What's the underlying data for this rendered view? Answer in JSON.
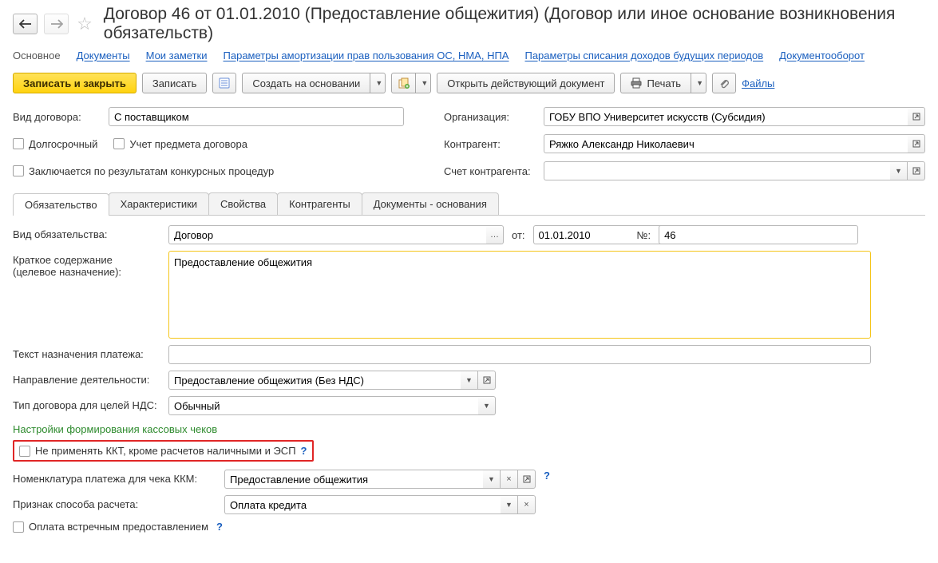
{
  "header": {
    "title": "Договор 46 от 01.01.2010 (Предоставление общежития) (Договор или иное основание возникновения обязательств)"
  },
  "nav": {
    "main": "Основное",
    "docs": "Документы",
    "notes": "Мои заметки",
    "amort": "Параметры амортизации прав пользования ОС, НМА, НПА",
    "income": "Параметры списания доходов будущих периодов",
    "workflow": "Документооборот"
  },
  "toolbar": {
    "save_close": "Записать и закрыть",
    "save": "Записать",
    "create_based": "Создать на основании",
    "open_active": "Открыть действующий документ",
    "print": "Печать",
    "files": "Файлы"
  },
  "left": {
    "contract_type_label": "Вид договора:",
    "contract_type_value": "С поставщиком",
    "long_term": "Долгосрочный",
    "track_subject": "Учет предмета договора",
    "by_tender": "Заключается по результатам конкурсных процедур"
  },
  "right": {
    "org_label": "Организация:",
    "org_value": "ГОБУ ВПО Университет искусств (Субсидия)",
    "counterparty_label": "Контрагент:",
    "counterparty_value": "Ряжко Александр Николаевич",
    "account_label": "Счет контрагента:",
    "account_value": ""
  },
  "tabs": {
    "t1": "Обязательство",
    "t2": "Характеристики",
    "t3": "Свойства",
    "t4": "Контрагенты",
    "t5": "Документы - основания"
  },
  "obl": {
    "kind_label": "Вид обязательства:",
    "kind_value": "Договор",
    "from_label": "от:",
    "date_value": "01.01.2010",
    "num_label": "№:",
    "num_value": "46",
    "summary_label1": "Краткое содержание",
    "summary_label2": "(целевое назначение):",
    "summary_value": "Предоставление общежития",
    "payment_text_label": "Текст назначения платежа:",
    "payment_text_value": "",
    "activity_label": "Направление деятельности:",
    "activity_value": "Предоставление общежития (Без НДС)",
    "vat_type_label": "Тип договора для целей НДС:",
    "vat_type_value": "Обычный",
    "section_title": "Настройки формирования кассовых чеков",
    "no_kkt_label": "Не применять ККТ, кроме расчетов наличными и ЭСП",
    "nomen_label": "Номенклатура платежа для чека ККМ:",
    "nomen_value": "Предоставление общежития",
    "pay_method_label": "Признак способа расчета:",
    "pay_method_value": "Оплата кредита",
    "counter_pay_label": "Оплата встречным предоставлением"
  }
}
